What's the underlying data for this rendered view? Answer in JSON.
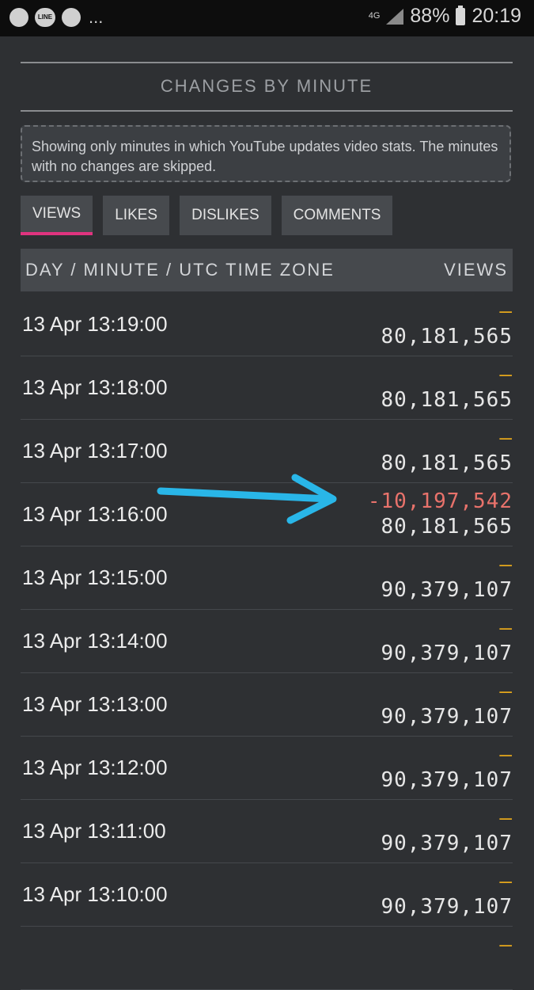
{
  "status_bar": {
    "apps": [
      "whatsapp-icon",
      "line-icon",
      "twitter-icon"
    ],
    "line_text": "LINE",
    "more": "...",
    "network": "4G",
    "battery": "88%",
    "time": "20:19"
  },
  "section": {
    "title": "CHANGES BY MINUTE",
    "notice": "Showing only minutes in which YouTube updates video stats. The minutes with no changes are skipped."
  },
  "tabs": [
    {
      "label": "VIEWS",
      "active": true
    },
    {
      "label": "LIKES",
      "active": false
    },
    {
      "label": "DISLIKES",
      "active": false
    },
    {
      "label": "COMMENTS",
      "active": false
    }
  ],
  "table": {
    "col_time": "DAY / MINUTE / UTC TIME ZONE",
    "col_value": "VIEWS",
    "rows": [
      {
        "time": "13 Apr 13:19:00",
        "change": "—",
        "value": "80,181,565"
      },
      {
        "time": "13 Apr 13:18:00",
        "change": "—",
        "value": "80,181,565"
      },
      {
        "time": "13 Apr 13:17:00",
        "change": "—",
        "value": "80,181,565"
      },
      {
        "time": "13 Apr 13:16:00",
        "change": "-10,197,542",
        "value": "80,181,565"
      },
      {
        "time": "13 Apr 13:15:00",
        "change": "—",
        "value": "90,379,107"
      },
      {
        "time": "13 Apr 13:14:00",
        "change": "—",
        "value": "90,379,107"
      },
      {
        "time": "13 Apr 13:13:00",
        "change": "—",
        "value": "90,379,107"
      },
      {
        "time": "13 Apr 13:12:00",
        "change": "—",
        "value": "90,379,107"
      },
      {
        "time": "13 Apr 13:11:00",
        "change": "—",
        "value": "90,379,107"
      },
      {
        "time": "13 Apr 13:10:00",
        "change": "—",
        "value": "90,379,107"
      },
      {
        "time": "",
        "change": "—",
        "value": ""
      }
    ]
  },
  "colors": {
    "accent_tab": "#e0347f",
    "change_dash": "#e5a71c",
    "change_negative": "#e8726b",
    "annotation_arrow": "#29b6e8"
  }
}
